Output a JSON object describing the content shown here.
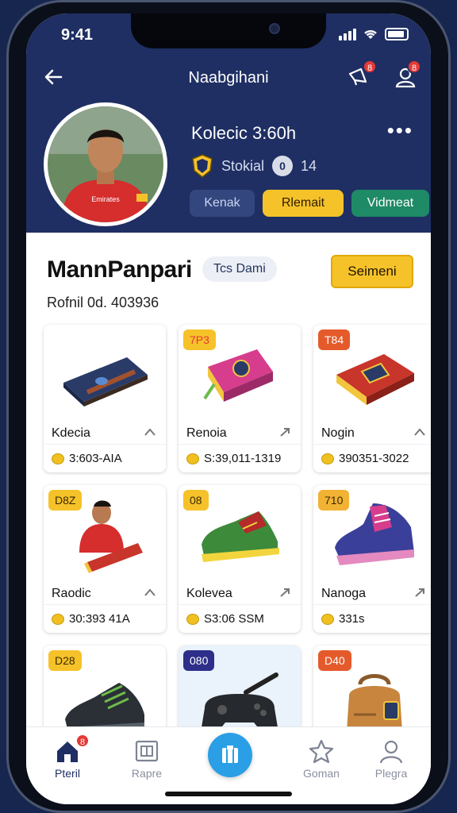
{
  "status": {
    "time": "9:41"
  },
  "header": {
    "title": "Naabgihani",
    "notif_badge": "8",
    "profile_badge": "8"
  },
  "profile": {
    "name": "Kolecic 3:60h",
    "rank_label": "Stokial",
    "level_icon": "0",
    "level_value": "14",
    "buttons": [
      "Kenak",
      "Rlemait",
      "Vidmeat"
    ]
  },
  "section": {
    "title": "MannPanpari",
    "chip": "Tcs Dami",
    "cta": "Seimeni",
    "subline": "Rofnil 0d. 403936"
  },
  "items": [
    {
      "tag": "",
      "tag_color": "",
      "name": "Kdecia",
      "price": "3:603-AIA",
      "icon": "wallet-icon"
    },
    {
      "tag": "7P3",
      "tag_color": "#f6c22a",
      "name": "Renoia",
      "price": "S:39,011-1319",
      "icon": "pink-book-icon"
    },
    {
      "tag": "T84",
      "tag_color": "#e55a2b",
      "name": "Nogin",
      "price": "390351-3022",
      "icon": "book-icon"
    },
    {
      "tag": "D8Z",
      "tag_color": "#f6c22a",
      "name": "Raodic",
      "price": "30:393 41A",
      "icon": "player-icon"
    },
    {
      "tag": "08",
      "tag_color": "#f6c22a",
      "name": "Kolevea",
      "price": "S3:06 SSM",
      "icon": "green-shoe-icon"
    },
    {
      "tag": "710",
      "tag_color": "#f2b233",
      "name": "Nanoga",
      "price": "331s",
      "icon": "purple-shoe-icon"
    },
    {
      "tag": "D28",
      "tag_color": "#f6c22a",
      "name": "",
      "price": "",
      "icon": "black-shoe-icon"
    },
    {
      "tag": "080",
      "tag_color": "#2d2f8a",
      "name": "",
      "price": "",
      "icon": "controller-icon"
    },
    {
      "tag": "D40",
      "tag_color": "#e55a2b",
      "name": "",
      "price": "",
      "icon": "backpack-icon"
    }
  ],
  "tabs": [
    {
      "label": "Pteril",
      "badge": "8",
      "icon": "home-icon",
      "active": true
    },
    {
      "label": "Rapre",
      "icon": "box-icon"
    },
    {
      "label": "",
      "icon": "store-icon"
    },
    {
      "label": "Goman",
      "icon": "star-icon"
    },
    {
      "label": "Plegra",
      "icon": "user-icon"
    }
  ],
  "colors": {
    "header_bg": "#1f2f63",
    "accent_yellow": "#f6c22a",
    "accent_green": "#1f8a66",
    "fab_blue": "#2a9fe6"
  }
}
